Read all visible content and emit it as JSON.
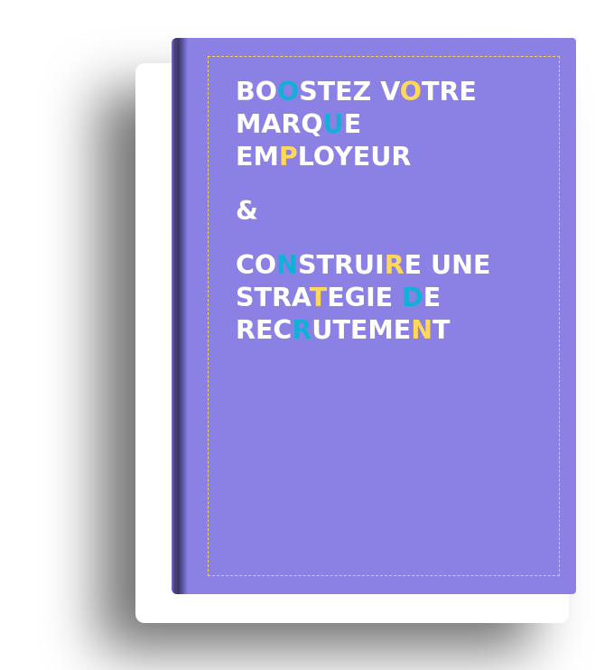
{
  "colors": {
    "cover": "#8b80e4",
    "white": "#ffffff",
    "blue": "#12b0d8",
    "yellow": "#ffd85a",
    "stitch": "#f2d35a"
  },
  "cover": {
    "lines": [
      {
        "segments": [
          {
            "text": "BO",
            "color": "white"
          },
          {
            "text": "O",
            "color": "blue"
          },
          {
            "text": "STEZ V",
            "color": "white"
          },
          {
            "text": "O",
            "color": "yellow"
          },
          {
            "text": "TRE",
            "color": "white"
          }
        ]
      },
      {
        "segments": [
          {
            "text": "MARQ",
            "color": "white"
          },
          {
            "text": "U",
            "color": "blue"
          },
          {
            "text": "E",
            "color": "white"
          }
        ]
      },
      {
        "segments": [
          {
            "text": "EM",
            "color": "white"
          },
          {
            "text": "P",
            "color": "yellow"
          },
          {
            "text": "LOYEUR",
            "color": "white"
          }
        ],
        "gap_after": true
      },
      {
        "segments": [
          {
            "text": "&",
            "color": "white"
          }
        ],
        "gap_after": true
      },
      {
        "segments": [
          {
            "text": "CO",
            "color": "white"
          },
          {
            "text": "N",
            "color": "blue"
          },
          {
            "text": "STRUI",
            "color": "white"
          },
          {
            "text": "R",
            "color": "yellow"
          },
          {
            "text": "E UNE",
            "color": "white"
          }
        ]
      },
      {
        "segments": [
          {
            "text": "STRA",
            "color": "white"
          },
          {
            "text": "T",
            "color": "yellow"
          },
          {
            "text": "EGIE ",
            "color": "white"
          },
          {
            "text": "D",
            "color": "blue"
          },
          {
            "text": "E",
            "color": "white"
          }
        ]
      },
      {
        "segments": [
          {
            "text": "REC",
            "color": "white"
          },
          {
            "text": "R",
            "color": "blue"
          },
          {
            "text": "UTEME",
            "color": "white"
          },
          {
            "text": "N",
            "color": "yellow"
          },
          {
            "text": "T",
            "color": "white"
          }
        ]
      }
    ]
  }
}
